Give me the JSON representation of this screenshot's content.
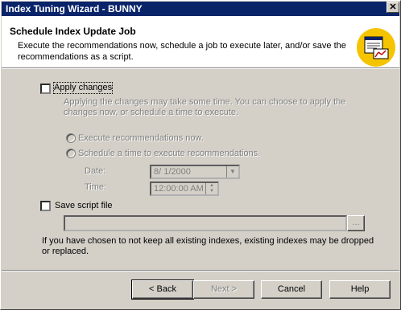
{
  "window": {
    "title": "Index Tuning Wizard - BUNNY",
    "close_glyph": "✕"
  },
  "header": {
    "title": "Schedule Index Update Job",
    "description": "Execute the recommendations now, schedule a job to execute later, and/or save the recommendations as a script.",
    "icon": "wizard-chart-icon"
  },
  "apply": {
    "label": "Apply changes",
    "checked": false,
    "note": "Applying the changes may take some time. You can choose to apply the changes now, or schedule a time to execute.",
    "option_now": "Execute recommendations now.",
    "option_schedule": "Schedule a time to execute recommendations.",
    "date_label": "Date:",
    "date_value": "8/  1/2000",
    "time_label": "Time:",
    "time_value": "12:00:00 AM"
  },
  "script": {
    "label": "Save script file",
    "checked": false,
    "path_value": "",
    "browse_label": "..."
  },
  "warning": "If you have chosen to not keep all existing indexes, existing indexes may be dropped or replaced.",
  "buttons": {
    "back": "< Back",
    "next": "Next >",
    "cancel": "Cancel",
    "help": "Help"
  },
  "colors": {
    "titlebar": "#0a246a",
    "face": "#d4d0c8",
    "disabled_text": "#808080"
  }
}
